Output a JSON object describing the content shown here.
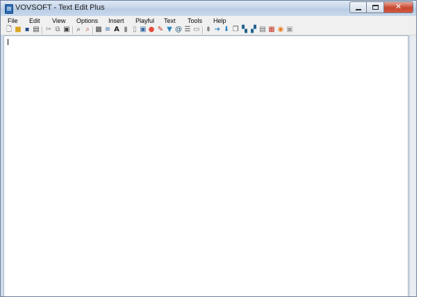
{
  "window": {
    "title": "VOVSOFT - Text Edit Plus"
  },
  "menu": [
    {
      "id": "file",
      "label": "File"
    },
    {
      "id": "edit",
      "label": "Edit"
    },
    {
      "id": "view",
      "label": "View"
    },
    {
      "id": "options",
      "label": "Options"
    },
    {
      "id": "insert",
      "label": "Insert"
    },
    {
      "id": "playful",
      "label": "Playful"
    },
    {
      "id": "text",
      "label": "Text"
    },
    {
      "id": "tools",
      "label": "Tools"
    },
    {
      "id": "help",
      "label": "Help"
    }
  ],
  "toolbar_icons": [
    "new-file-icon",
    "open-folder-icon",
    "save-icon",
    "print-icon",
    "cut-icon",
    "copy-icon",
    "paste-icon",
    "find-icon",
    "find-replace-icon",
    "image-icon",
    "database-icon",
    "font-icon",
    "lock-icon",
    "unlock-icon",
    "web-icon",
    "color-icon",
    "brush-icon",
    "filter-icon",
    "email-icon",
    "list-icon",
    "message-icon",
    "indent-icon",
    "arrow-right-icon",
    "arrow-down-icon",
    "copy-doc-icon",
    "tile-icon",
    "cascade-icon",
    "document-icon",
    "calendar-icon",
    "search-file-icon",
    "picture-icon"
  ],
  "colors": {
    "titlebar": "#c6d6ea",
    "menubar": "#f0f0f0",
    "close_button": "#c7462f",
    "editor_bg": "#ffffff"
  },
  "editor": {
    "content": ""
  }
}
